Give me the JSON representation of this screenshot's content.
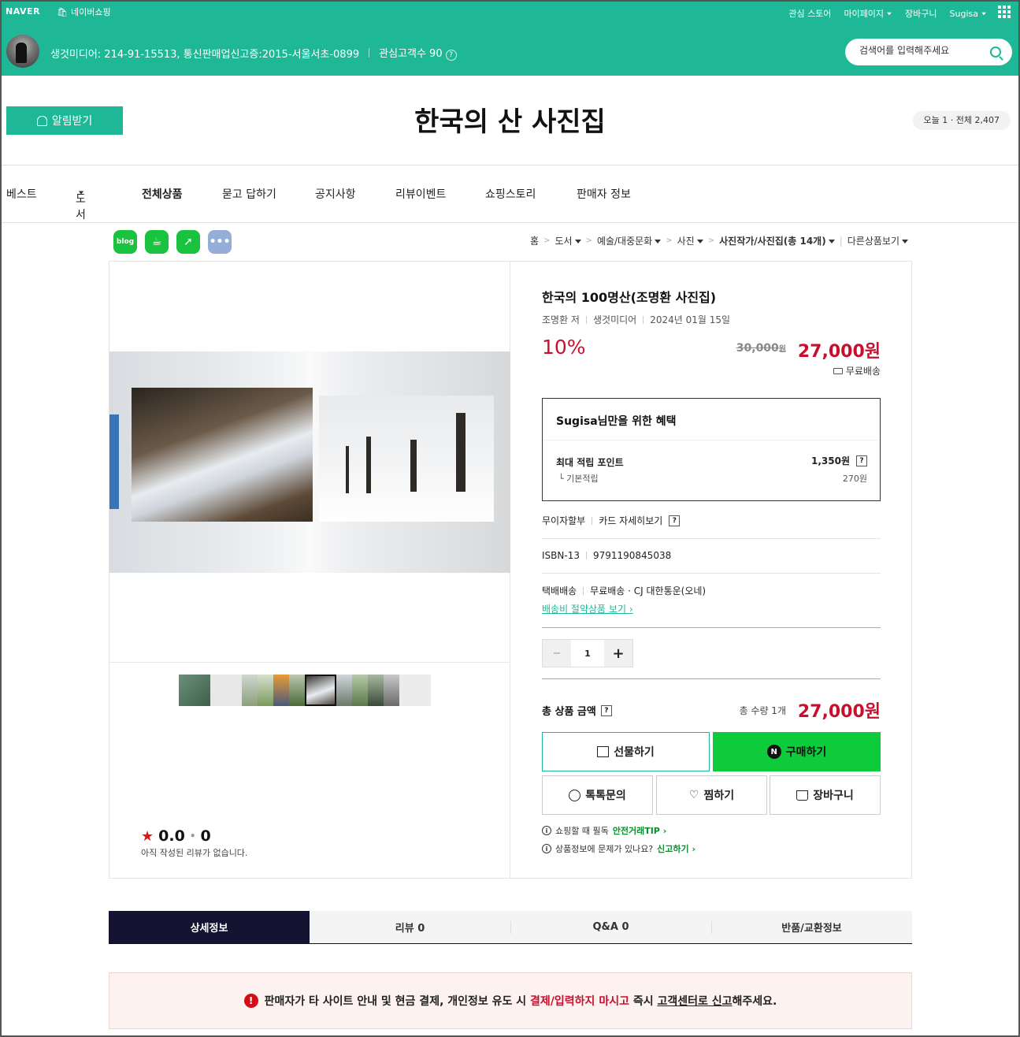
{
  "gnb": {
    "logo": "NAVER",
    "shopping": "네이버쇼핑",
    "links": [
      "관심 스토어",
      "마이페이지",
      "장바구니",
      "Sugisa"
    ]
  },
  "seller": {
    "info": "생것미디어: 214-91-15513, 통신판매업신고증:2015-서울서초-0899",
    "followers": "관심고객수 90"
  },
  "search": {
    "placeholder": "검색어를 입력해주세요"
  },
  "store": {
    "alarm_button": "알림받기",
    "title": "한국의 산 사진집",
    "visits": "오늘 1 · 전체 2,407"
  },
  "nav": {
    "items": [
      "베스트",
      "도서",
      "전체상품",
      "묻고 답하기",
      "공지사항",
      "리뷰이벤트",
      "쇼핑스토리",
      "판매자 정보"
    ]
  },
  "share": {
    "blog": "blog"
  },
  "breadcrumb": {
    "items": [
      "홈",
      "도서",
      "예술/대중문화",
      "사진",
      "사진작가/사진집(총 14개)",
      "다른상품보기"
    ]
  },
  "product": {
    "title": "한국의 100명산(조명환 사진집)",
    "author": "조명환 저",
    "publisher": "생것미디어",
    "date": "2024년 01월 15일",
    "discount": "10%",
    "original_price": "30,000",
    "original_unit": "원",
    "price": "27,000원",
    "shipping": "무료배송"
  },
  "benefit": {
    "title_user": "Sugisa",
    "title_rest": "님만을 위한 혜택",
    "max_points_label": "최대 적립 포인트",
    "max_points": "1,350원",
    "base_label": "└ 기본적립",
    "base_points": "270원"
  },
  "installment": {
    "label": "무이자할부",
    "link": "카드 자세히보기"
  },
  "isbn": {
    "label": "ISBN-13",
    "value": "9791190845038"
  },
  "delivery": {
    "label": "택배배송",
    "value": "무료배송 · CJ 대한통운(오네)",
    "link": "배송비 절약상품 보기"
  },
  "quantity": {
    "minus": "−",
    "value": "1",
    "plus": "+"
  },
  "total": {
    "label": "총 상품 금액",
    "qty": "총 수량 1개",
    "price": "27,000원"
  },
  "buttons": {
    "gift": "선물하기",
    "buy": "구매하기",
    "npay": "N",
    "talk": "톡톡문의",
    "wish": "찜하기",
    "cart": "장바구니"
  },
  "notices": {
    "n1_text": "쇼핑할 때 필독",
    "n1_link": "안전거래TIP",
    "n2_text": "상품정보에 문제가 있나요?",
    "n2_link": "신고하기"
  },
  "review": {
    "score": "0.0",
    "count": "0",
    "empty": "아직 작성된 리뷰가 없습니다."
  },
  "tabs": [
    "상세정보",
    "리뷰 0",
    "Q&A 0",
    "반품/교환정보"
  ],
  "warning": {
    "part1": "판매자가 타 사이트 안내 및 현금 결제, 개인정보 유도 시 ",
    "part2": "결제/입력하지 마시고",
    "part3": " 즉시 ",
    "part4": "고객센터로 신고",
    "part5": "해주세요."
  },
  "colors": {
    "brand_green": "#1fb896",
    "price_red": "#c8102e",
    "buy_green": "#0ecb3b",
    "tab_active": "#141432"
  }
}
